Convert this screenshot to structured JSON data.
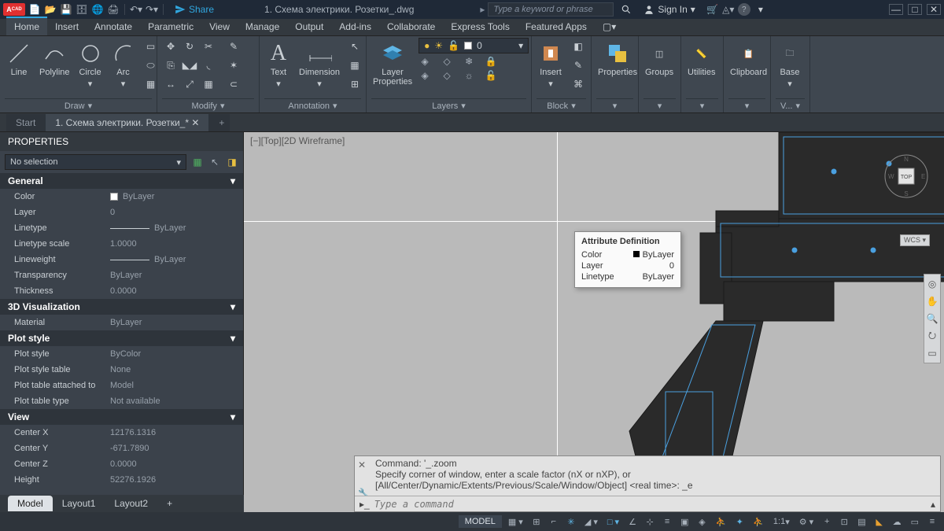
{
  "titlebar": {
    "file_title": "1. Схема электрики. Розетки_.dwg",
    "search_placeholder": "Type a keyword or phrase",
    "share": "Share",
    "signin": "Sign In"
  },
  "ribbon_tabs": [
    "Home",
    "Insert",
    "Annotate",
    "Parametric",
    "View",
    "Manage",
    "Output",
    "Add-ins",
    "Collaborate",
    "Express Tools",
    "Featured Apps"
  ],
  "ribbon": {
    "draw": {
      "title": "Draw",
      "line": "Line",
      "polyline": "Polyline",
      "circle": "Circle",
      "arc": "Arc"
    },
    "modify": {
      "title": "Modify"
    },
    "annotation": {
      "title": "Annotation",
      "text": "Text",
      "dimension": "Dimension"
    },
    "layers": {
      "title": "Layers",
      "layer_properties": "Layer\nProperties",
      "layer_sel": "0"
    },
    "block": {
      "title": "Block",
      "insert": "Insert"
    },
    "properties": {
      "title": "Properties",
      "btn": "Properties"
    },
    "groups": "Groups",
    "utilities": "Utilities",
    "clipboard": "Clipboard",
    "view": "Base",
    "view_panel_title": "V..."
  },
  "doc_tabs": {
    "start": "Start",
    "doc": "1. Схема электрики. Розетки_*"
  },
  "properties": {
    "title": "PROPERTIES",
    "selection": "No selection",
    "sections": {
      "general": "General",
      "viz3d": "3D Visualization",
      "plot": "Plot style",
      "view": "View"
    },
    "rows": {
      "color": {
        "k": "Color",
        "v": "ByLayer"
      },
      "layer": {
        "k": "Layer",
        "v": "0"
      },
      "linetype": {
        "k": "Linetype",
        "v": "ByLayer"
      },
      "ltscale": {
        "k": "Linetype scale",
        "v": "1.0000"
      },
      "lweight": {
        "k": "Lineweight",
        "v": "ByLayer"
      },
      "transp": {
        "k": "Transparency",
        "v": "ByLayer"
      },
      "thick": {
        "k": "Thickness",
        "v": "0.0000"
      },
      "material": {
        "k": "Material",
        "v": "ByLayer"
      },
      "pstyle": {
        "k": "Plot style",
        "v": "ByColor"
      },
      "ptable": {
        "k": "Plot style table",
        "v": "None"
      },
      "pattach": {
        "k": "Plot table attached to",
        "v": "Model"
      },
      "ptype": {
        "k": "Plot table type",
        "v": "Not available"
      },
      "cx": {
        "k": "Center X",
        "v": "12176.1316"
      },
      "cy": {
        "k": "Center Y",
        "v": "-671.7890"
      },
      "cz": {
        "k": "Center Z",
        "v": "0.0000"
      },
      "height": {
        "k": "Height",
        "v": "52276.1926"
      }
    }
  },
  "canvas": {
    "viewlabel": "[−][Top][2D Wireframe]",
    "wcs": "WCS",
    "top": "TOP",
    "n": "N",
    "s": "S",
    "e": "E",
    "w": "W"
  },
  "tooltip": {
    "title": "Attribute Definition",
    "color_k": "Color",
    "color_v": "ByLayer",
    "layer_k": "Layer",
    "layer_v": "0",
    "lt_k": "Linetype",
    "lt_v": "ByLayer"
  },
  "command": {
    "line1": "Command: '_.zoom",
    "line2": "Specify corner of window, enter a scale factor (nX or nXP), or",
    "line3": "[All/Center/Dynamic/Extents/Previous/Scale/Window/Object] <real time>: _e",
    "placeholder": "Type a command"
  },
  "bottom_tabs": {
    "model": "Model",
    "l1": "Layout1",
    "l2": "Layout2"
  },
  "status": {
    "model": "MODEL",
    "scale": "1:1"
  }
}
